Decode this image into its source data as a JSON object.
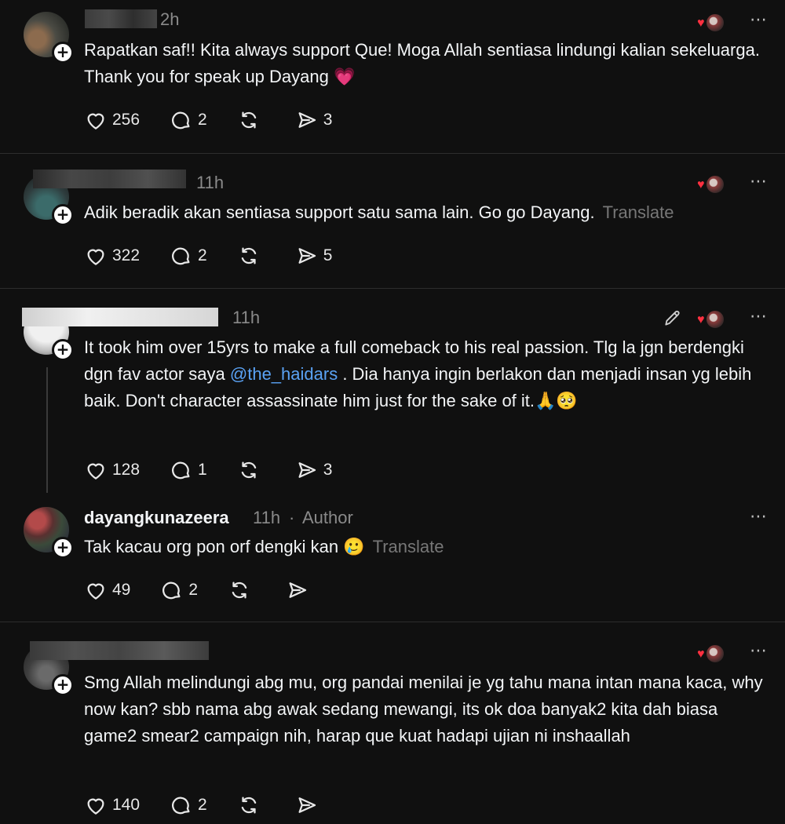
{
  "posts": [
    {
      "time": "2h",
      "text": "Rapatkan saf!! Kita always support Que! Moga Allah sentiasa lindungi kalian sekeluarga. Thank you for speak up Dayang 💗",
      "likes": "256",
      "replies": "2",
      "reposts": "",
      "shares": "3"
    },
    {
      "time": "11h",
      "text": "Adik beradik akan sentiasa support satu sama lain. Go go Dayang.",
      "translate": "Translate",
      "likes": "322",
      "replies": "2",
      "reposts": "",
      "shares": "5"
    },
    {
      "time": "11h",
      "text_before": "It took him over 15yrs to make a full comeback to his real passion. Tlg la jgn berdengki dgn fav actor saya ",
      "mention": "@the_haidars",
      "text_after": " . Dia hanya ingin berlakon dan menjadi insan yg lebih baik. Don't character assassinate him just for the sake of it.🙏🥺",
      "likes": "128",
      "replies": "1",
      "reposts": "",
      "shares": "3"
    },
    {
      "username": "dayangkunazeera",
      "time": "11h",
      "dot": "·",
      "author_tag": "Author",
      "text": "Tak kacau org pon orf dengki kan 🥲",
      "translate": "Translate",
      "likes": "49",
      "replies": "2",
      "reposts": "",
      "shares": ""
    },
    {
      "time": "",
      "text": "Smg Allah melindungi abg mu, org pandai menilai je yg tahu mana intan mana kaca, why now kan? sbb nama abg awak sedang mewangi, its ok doa banyak2 kita dah biasa game2 smear2 campaign nih, harap que kuat hadapi ujian ni inshaallah",
      "likes": "140",
      "replies": "2",
      "reposts": "",
      "shares": ""
    }
  ],
  "icons": {
    "more": "⋯",
    "plus": "+",
    "heart": "heart-icon",
    "comment": "comment-icon",
    "repost": "repost-icon",
    "share": "share-icon",
    "edit": "pencil-icon"
  },
  "colors": {
    "background": "#101010",
    "text": "#f3f5f7",
    "muted": "#8a8a8a",
    "mention": "#5aa2f4",
    "like_heart": "#ff3040"
  }
}
